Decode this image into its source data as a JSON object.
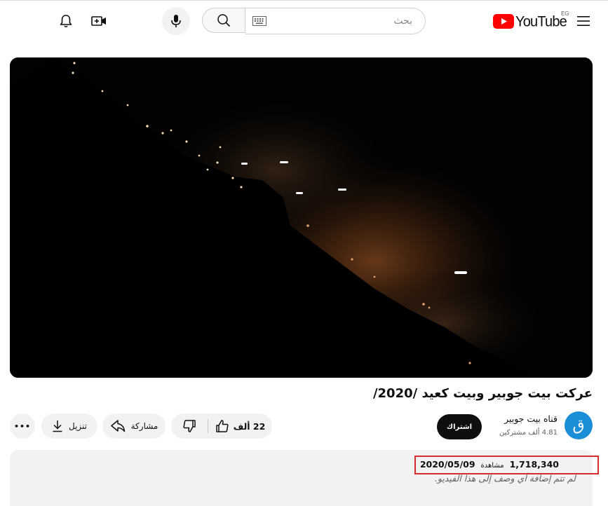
{
  "colors": {
    "brand_red": "#FF0000",
    "subscribe_bg": "#0F0F0F",
    "avatar_bg": "#1B8ED7",
    "pill_bg": "#F2F2F2",
    "highlight": "#D62C2C"
  },
  "header": {
    "logo_text": "YouTube",
    "country_code": "EG",
    "search_placeholder": "بحث",
    "icons": {
      "menu": "hamburger-menu-icon",
      "search": "search-icon",
      "keyboard": "keyboard-icon",
      "mic": "microphone-icon",
      "create": "create-video-icon",
      "notifications": "bell-icon"
    }
  },
  "video": {
    "title": "عركت بيت جوبير وبيت كعيد /2020/"
  },
  "channel": {
    "avatar_letter": "ق",
    "name": "قناه بيت جوبير",
    "subscribers": "4.81 ألف مشتركين",
    "subscribe_label": "اشتراك"
  },
  "actions": {
    "like_count": "22 ألف",
    "share_label": "مشاركة",
    "download_label": "تنزيل",
    "more_label": "•••"
  },
  "description": {
    "views": "1,718,340",
    "views_word": "مشاهدة",
    "date": "2020/05/09",
    "text": "لم تتم إضافة أي وصف إلى هذا الفيديو."
  }
}
